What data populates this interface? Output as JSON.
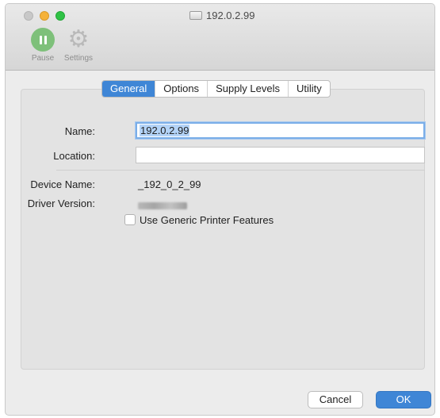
{
  "window": {
    "title": "192.0.2.99"
  },
  "toolbar": {
    "pause_label": "Pause",
    "settings_label": "Settings"
  },
  "tabs": [
    {
      "label": "General",
      "active": true
    },
    {
      "label": "Options",
      "active": false
    },
    {
      "label": "Supply Levels",
      "active": false
    },
    {
      "label": "Utility",
      "active": false
    }
  ],
  "general": {
    "name_label": "Name:",
    "name_value": "192.0.2.99",
    "location_label": "Location:",
    "location_value": "",
    "device_name_label": "Device Name:",
    "device_name_value": "_192_0_2_99",
    "driver_version_label": "Driver Version:",
    "generic_features_label": "Use Generic Printer Features",
    "generic_features_checked": false
  },
  "buttons": {
    "cancel_label": "Cancel",
    "ok_label": "OK"
  },
  "colors": {
    "accent": "#3f86d6",
    "pause_green": "#7ec07a"
  }
}
